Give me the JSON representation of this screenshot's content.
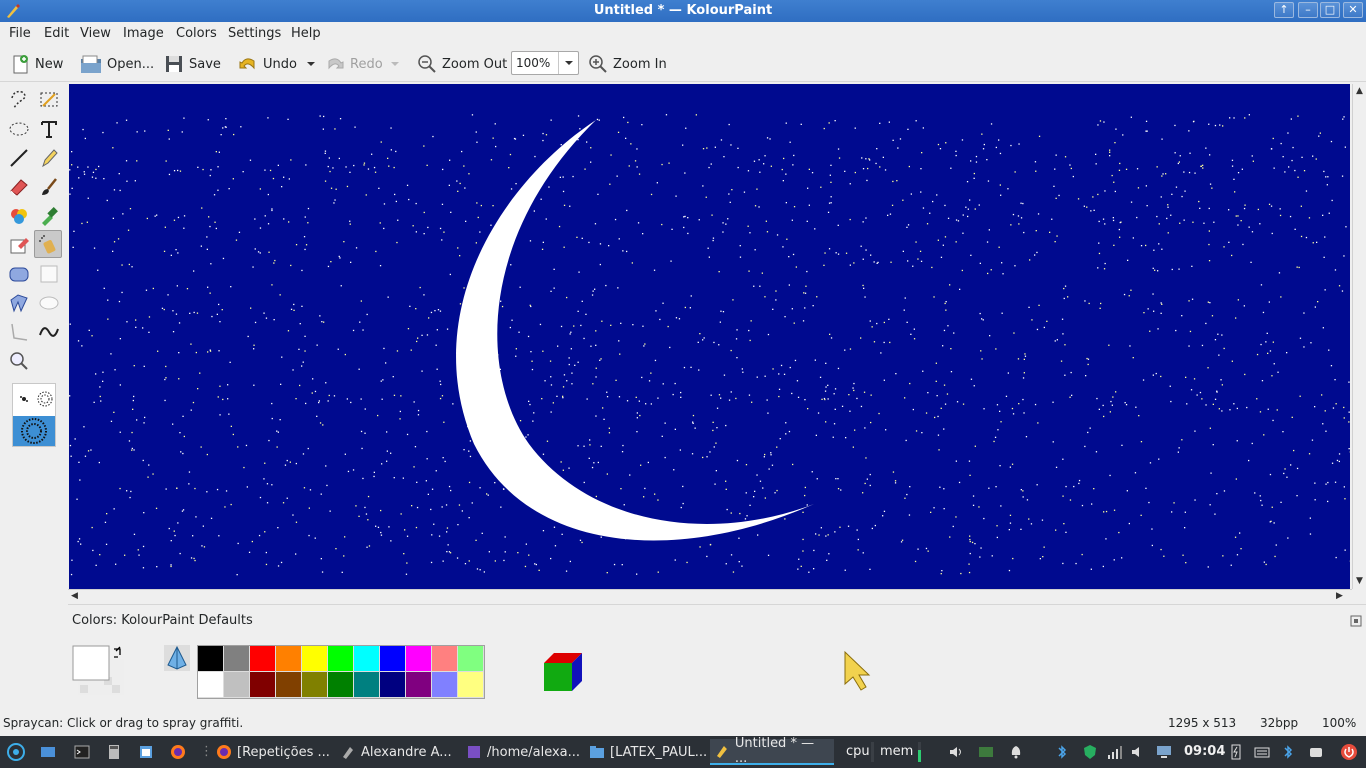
{
  "window": {
    "title": "Untitled * — KolourPaint",
    "controls": [
      "↑",
      "–",
      "□",
      "✕"
    ]
  },
  "menu": [
    "File",
    "Edit",
    "View",
    "Image",
    "Colors",
    "Settings",
    "Help"
  ],
  "toolbar": {
    "new": "New",
    "open": "Open...",
    "save": "Save",
    "undo": "Undo",
    "redo": "Redo",
    "zoom_out": "Zoom Out",
    "zoom_value": "100%",
    "zoom_in": "Zoom In"
  },
  "tools": [
    "free-form-selection-tool",
    "rectangular-selection-tool",
    "elliptical-selection-tool",
    "text-tool",
    "line-tool",
    "pen-tool",
    "eraser-tool",
    "brush-tool",
    "flood-fill-tool",
    "color-picker-tool",
    "color-eraser-tool",
    "spraycan-tool",
    "rounded-rectangle-tool",
    "rectangle-tool",
    "polygon-tool",
    "ellipse-tool",
    "polyline-tool",
    "curve-tool",
    "zoom-tool"
  ],
  "active_tool": "spraycan-tool",
  "colors": {
    "label": "Colors: KolourPaint Defaults",
    "foreground": "#ffffff",
    "background": "#ffffff",
    "canvas_background": "#000a8f",
    "palette_top": [
      "#000000",
      "#808080",
      "#ff0000",
      "#ff8000",
      "#ffff00",
      "#00ff00",
      "#00ffff",
      "#0000ff",
      "#ff00ff",
      "#ff8080",
      "#80ff80"
    ],
    "palette_bottom": [
      "#ffffff",
      "#c0c0c0",
      "#800000",
      "#804000",
      "#808000",
      "#008000",
      "#008080",
      "#000080",
      "#800080",
      "#8080ff",
      "#ffff80"
    ]
  },
  "status": {
    "message": "Spraycan: Click or drag to spray graffiti.",
    "dimensions": "1295 x 513",
    "depth": "32bpp",
    "zoom": "100%"
  },
  "taskbar": {
    "items": [
      "[Repetições ...",
      "Alexandre A...",
      "/home/alexa...",
      "[LATEX_PAUL...",
      "Untitled * — ..."
    ],
    "active_index": 4,
    "cpu_label": "cpu",
    "mem_label": "mem",
    "clock": "09:04"
  }
}
